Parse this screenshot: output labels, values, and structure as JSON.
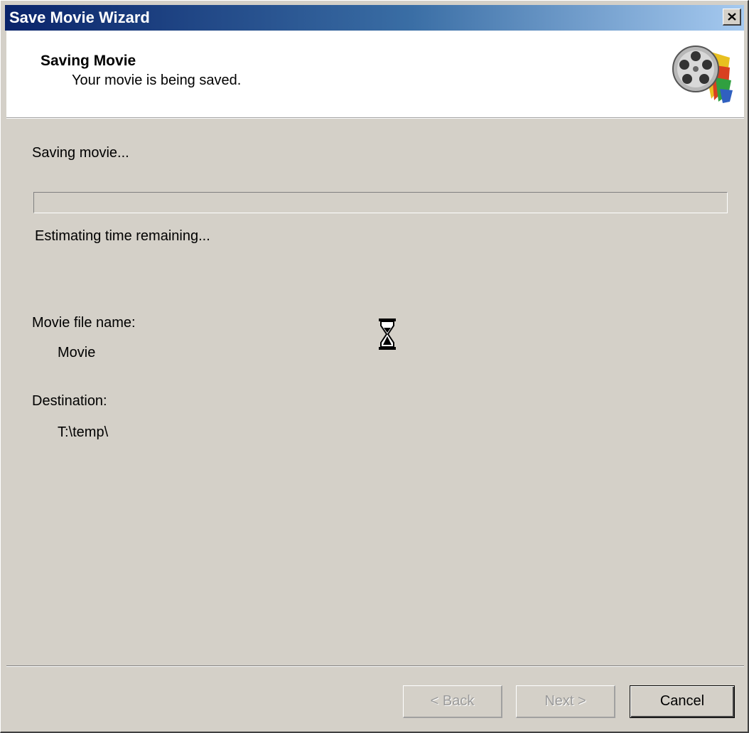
{
  "window": {
    "title": "Save Movie Wizard"
  },
  "header": {
    "title": "Saving Movie",
    "subtitle": "Your movie is being saved.",
    "icon": "film-reel-icon"
  },
  "status": {
    "saving_label": "Saving movie...",
    "progress_fraction": 0,
    "time_label": "Estimating time remaining..."
  },
  "file": {
    "name_label": "Movie file name:",
    "name_value": "Movie",
    "destination_label": "Destination:",
    "destination_value": "T:\\temp\\"
  },
  "cursor": {
    "icon": "hourglass-icon"
  },
  "buttons": {
    "back_label": "< Back",
    "next_label": "Next >",
    "cancel_label": "Cancel"
  },
  "colors": {
    "titlebar_start": "#0a246a",
    "titlebar_end": "#a6caf0",
    "dialog_bg": "#d4d0c8",
    "header_bg": "#ffffff"
  }
}
